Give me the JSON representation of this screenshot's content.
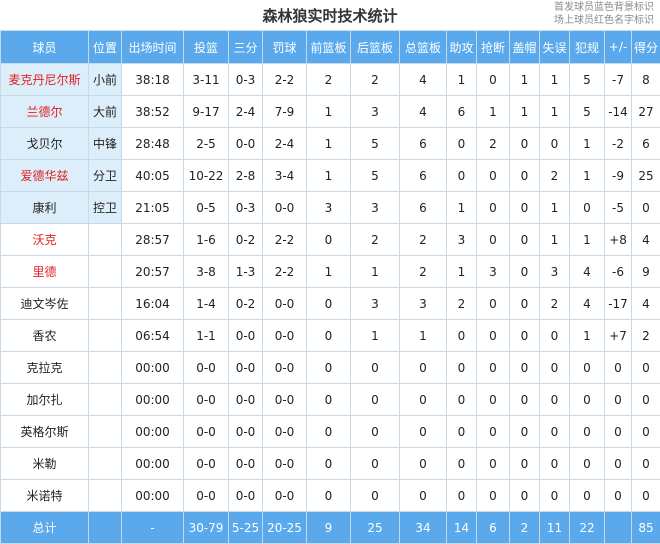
{
  "title": "森林狼实时技术统计",
  "legend": {
    "line1": "首发球员蓝色背景标识",
    "line2": "场上球员红色名字标识"
  },
  "colors": {
    "header_bg": "#5aa9ec",
    "starter_bg": "#ddeefb",
    "on_court_name": "#e02020"
  },
  "columns": [
    "球员",
    "位置",
    "出场时间",
    "投篮",
    "三分",
    "罚球",
    "前篮板",
    "后篮板",
    "总篮板",
    "助攻",
    "抢断",
    "盖帽",
    "失误",
    "犯规",
    "+/-",
    "得分"
  ],
  "rows": [
    {
      "starter": true,
      "on_court": true,
      "cells": [
        "麦克丹尼尔斯",
        "小前",
        "38:18",
        "3-11",
        "0-3",
        "2-2",
        "2",
        "2",
        "4",
        "1",
        "0",
        "1",
        "1",
        "5",
        "-7",
        "8"
      ]
    },
    {
      "starter": true,
      "on_court": true,
      "cells": [
        "兰德尔",
        "大前",
        "38:52",
        "9-17",
        "2-4",
        "7-9",
        "1",
        "3",
        "4",
        "6",
        "1",
        "1",
        "1",
        "5",
        "-14",
        "27"
      ]
    },
    {
      "starter": true,
      "on_court": false,
      "cells": [
        "戈贝尔",
        "中锋",
        "28:48",
        "2-5",
        "0-0",
        "2-4",
        "1",
        "5",
        "6",
        "0",
        "2",
        "0",
        "0",
        "1",
        "-2",
        "6"
      ]
    },
    {
      "starter": true,
      "on_court": true,
      "cells": [
        "爱德华兹",
        "分卫",
        "40:05",
        "10-22",
        "2-8",
        "3-4",
        "1",
        "5",
        "6",
        "0",
        "0",
        "0",
        "2",
        "1",
        "-9",
        "25"
      ]
    },
    {
      "starter": true,
      "on_court": false,
      "cells": [
        "康利",
        "控卫",
        "21:05",
        "0-5",
        "0-3",
        "0-0",
        "3",
        "3",
        "6",
        "1",
        "0",
        "0",
        "1",
        "0",
        "-5",
        "0"
      ]
    },
    {
      "starter": false,
      "on_court": true,
      "cells": [
        "沃克",
        "",
        "28:57",
        "1-6",
        "0-2",
        "2-2",
        "0",
        "2",
        "2",
        "3",
        "0",
        "0",
        "1",
        "1",
        "+8",
        "4"
      ]
    },
    {
      "starter": false,
      "on_court": true,
      "cells": [
        "里德",
        "",
        "20:57",
        "3-8",
        "1-3",
        "2-2",
        "1",
        "1",
        "2",
        "1",
        "3",
        "0",
        "3",
        "4",
        "-6",
        "9"
      ]
    },
    {
      "starter": false,
      "on_court": false,
      "cells": [
        "迪文岑佐",
        "",
        "16:04",
        "1-4",
        "0-2",
        "0-0",
        "0",
        "3",
        "3",
        "2",
        "0",
        "0",
        "2",
        "4",
        "-17",
        "4"
      ]
    },
    {
      "starter": false,
      "on_court": false,
      "cells": [
        "香农",
        "",
        "06:54",
        "1-1",
        "0-0",
        "0-0",
        "0",
        "1",
        "1",
        "0",
        "0",
        "0",
        "0",
        "1",
        "+7",
        "2"
      ]
    },
    {
      "starter": false,
      "on_court": false,
      "cells": [
        "克拉克",
        "",
        "00:00",
        "0-0",
        "0-0",
        "0-0",
        "0",
        "0",
        "0",
        "0",
        "0",
        "0",
        "0",
        "0",
        "0",
        "0"
      ]
    },
    {
      "starter": false,
      "on_court": false,
      "cells": [
        "加尔扎",
        "",
        "00:00",
        "0-0",
        "0-0",
        "0-0",
        "0",
        "0",
        "0",
        "0",
        "0",
        "0",
        "0",
        "0",
        "0",
        "0"
      ]
    },
    {
      "starter": false,
      "on_court": false,
      "cells": [
        "英格尔斯",
        "",
        "00:00",
        "0-0",
        "0-0",
        "0-0",
        "0",
        "0",
        "0",
        "0",
        "0",
        "0",
        "0",
        "0",
        "0",
        "0"
      ]
    },
    {
      "starter": false,
      "on_court": false,
      "cells": [
        "米勒",
        "",
        "00:00",
        "0-0",
        "0-0",
        "0-0",
        "0",
        "0",
        "0",
        "0",
        "0",
        "0",
        "0",
        "0",
        "0",
        "0"
      ]
    },
    {
      "starter": false,
      "on_court": false,
      "cells": [
        "米诺特",
        "",
        "00:00",
        "0-0",
        "0-0",
        "0-0",
        "0",
        "0",
        "0",
        "0",
        "0",
        "0",
        "0",
        "0",
        "0",
        "0"
      ]
    }
  ],
  "totals": [
    "总计",
    "",
    "-",
    "30-79",
    "5-25",
    "20-25",
    "9",
    "25",
    "34",
    "14",
    "6",
    "2",
    "11",
    "22",
    "",
    "85"
  ]
}
